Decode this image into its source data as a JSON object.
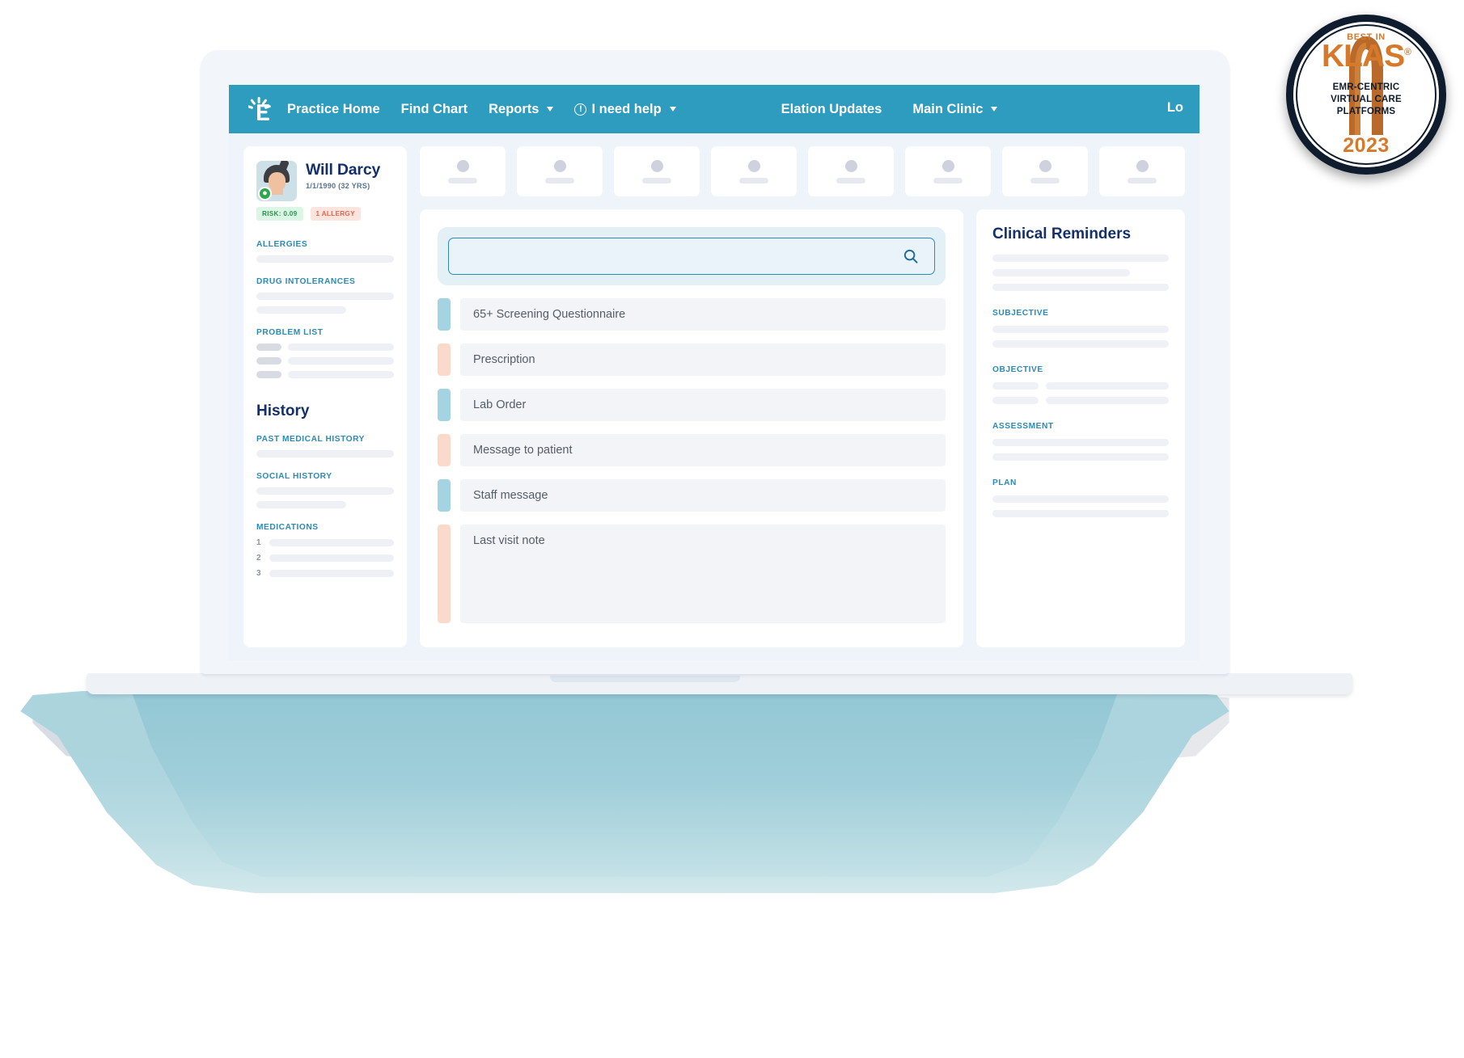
{
  "nav": {
    "logo_icon": "elation-logo-icon",
    "left_items": [
      {
        "label": "Practice Home",
        "has_caret": false,
        "icon": null
      },
      {
        "label": "Find Chart",
        "has_caret": false,
        "icon": null
      },
      {
        "label": "Reports",
        "has_caret": true,
        "icon": null
      },
      {
        "label": "I need help",
        "has_caret": true,
        "icon": "info-circle-icon"
      }
    ],
    "right_items": [
      {
        "label": "Elation Updates",
        "has_caret": false
      },
      {
        "label": "Main Clinic",
        "has_caret": true
      }
    ],
    "far_right_items": [
      {
        "label": "Lo"
      }
    ],
    "accent_color": "#2d9cbf"
  },
  "patient": {
    "name": "Will Darcy",
    "dob_age": "1/1/1990 (32 YRS)",
    "avatar_icon": "patient-avatar-icon",
    "status_icon": "globe-icon",
    "badges": [
      {
        "label": "RISK: 0.09",
        "type": "risk",
        "color": "#1d9e4e"
      },
      {
        "label": "1 ALLERGY",
        "type": "allergy",
        "color": "#ef6147"
      }
    ],
    "sections": [
      {
        "label": "ALLERGIES",
        "rows": [
          [
            100
          ]
        ]
      },
      {
        "label": "DRUG INTOLERANCES",
        "rows": [
          [
            100
          ],
          [
            65
          ]
        ]
      },
      {
        "label": "PROBLEM LIST",
        "rows": [
          [
            18,
            78
          ],
          [
            18,
            78
          ],
          [
            18,
            78
          ]
        ]
      }
    ],
    "history_title": "History",
    "history_sections": [
      {
        "label": "PAST MEDICAL HISTORY",
        "rows": [
          [
            100
          ]
        ]
      },
      {
        "label": "SOCIAL HISTORY",
        "rows": [
          [
            100
          ],
          [
            65
          ]
        ]
      }
    ],
    "medications_label": "MEDICATIONS",
    "medications": [
      "1",
      "2",
      "3"
    ]
  },
  "chips": {
    "count": 8
  },
  "search": {
    "value": "",
    "placeholder": "",
    "icon": "search-icon"
  },
  "action_items": [
    {
      "label": "65+ Screening Questionnaire",
      "tab_color": "#a4d3e2",
      "tall": false
    },
    {
      "label": "Prescription",
      "tab_color": "#fcdacb",
      "tall": false
    },
    {
      "label": "Lab Order",
      "tab_color": "#a4d3e2",
      "tall": false
    },
    {
      "label": "Message to patient",
      "tab_color": "#fcdacb",
      "tall": false
    },
    {
      "label": "Staff message",
      "tab_color": "#a4d3e2",
      "tall": false
    },
    {
      "label": "Last visit note",
      "tab_color": "#fcdacb",
      "tall": true
    }
  ],
  "reminders": {
    "title": "Clinical Reminders",
    "top_rows": [
      [
        100
      ],
      [
        78
      ],
      [
        100
      ]
    ],
    "sections": [
      {
        "label": "SUBJECTIVE",
        "rows": [
          [
            100
          ],
          [
            100
          ]
        ]
      },
      {
        "label": "OBJECTIVE",
        "rows": [
          [
            26,
            74
          ],
          [
            26,
            74
          ]
        ]
      },
      {
        "label": "ASSESSMENT",
        "rows": [
          [
            100
          ],
          [
            100
          ]
        ]
      },
      {
        "label": "PLAN",
        "rows": [
          [
            100
          ],
          [
            100
          ]
        ]
      }
    ]
  },
  "klas_badge": {
    "top_text": "BEST IN",
    "brand": "KLAS",
    "registered_mark": "®",
    "subtitle_line1": "EMR-CENTRIC",
    "subtitle_line2": "VIRTUAL CARE",
    "subtitle_line3": "PLATFORMS",
    "year": "2023",
    "accent_color": "#d7792b",
    "ring_color": "#0f1c2e"
  }
}
